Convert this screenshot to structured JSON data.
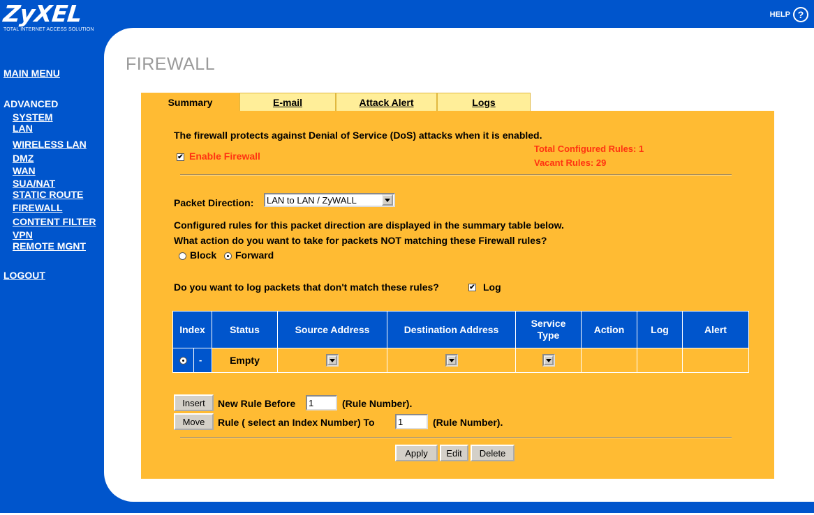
{
  "header": {
    "brand": "ZyXEL",
    "tagline": "Total Internet Access Solution",
    "help_label": "HELP",
    "help_icon": "?"
  },
  "sidebar": {
    "main_menu": "MAIN MENU",
    "advanced": "ADVANCED",
    "items": [
      "SYSTEM",
      "LAN",
      "WIRELESS LAN",
      "DMZ",
      "WAN",
      "SUA/NAT",
      "STATIC ROUTE",
      "FIREWALL",
      "CONTENT FILTER",
      "VPN",
      "REMOTE MGNT"
    ],
    "logout": "LOGOUT"
  },
  "page": {
    "title": "FIREWALL",
    "tabs": [
      {
        "label": "Summary",
        "active": true
      },
      {
        "label": "E-mail",
        "active": false
      },
      {
        "label": "Attack Alert",
        "active": false
      },
      {
        "label": "Logs",
        "active": false
      }
    ]
  },
  "firewall": {
    "intro": "The firewall protects against Denial of Service (DoS) attacks when it is enabled.",
    "enable_label": "Enable Firewall",
    "enable_checked": true,
    "total_rules": "Total Configured Rules: 1",
    "vacant_rules": "Vacant Rules: 29",
    "packet_direction_label": "Packet Direction:",
    "packet_direction_value": "LAN to LAN / ZyWALL",
    "configured_text": "Configured rules for this packet direction are displayed in the summary table below.",
    "action_question": "What action do you want to take for packets NOT matching these Firewall rules?",
    "block_label": "Block",
    "forward_label": "Forward",
    "selected_action": "Forward",
    "log_question": "Do you want to log packets that don't match these rules?",
    "log_label": "Log",
    "log_checked": true
  },
  "table": {
    "headers": [
      "Index",
      "Status",
      "Source Address",
      "Destination Address",
      "Service Type",
      "Action",
      "Log",
      "Alert"
    ],
    "row": {
      "index_marker": "-",
      "status": "Empty"
    }
  },
  "actions": {
    "insert_button": "Insert",
    "insert_text": "New Rule Before",
    "insert_value": "1",
    "insert_suffix": "(Rule Number).",
    "move_button": "Move",
    "move_text": "Rule ( select an Index Number) To",
    "move_value": "1",
    "move_suffix": "(Rule Number).",
    "apply": "Apply",
    "edit": "Edit",
    "delete": "Delete"
  },
  "colors": {
    "frame_blue": "#0055cc",
    "panel_orange": "#ffbb33",
    "tab_yellow": "#ffee99",
    "alert_red": "#ff3311"
  }
}
